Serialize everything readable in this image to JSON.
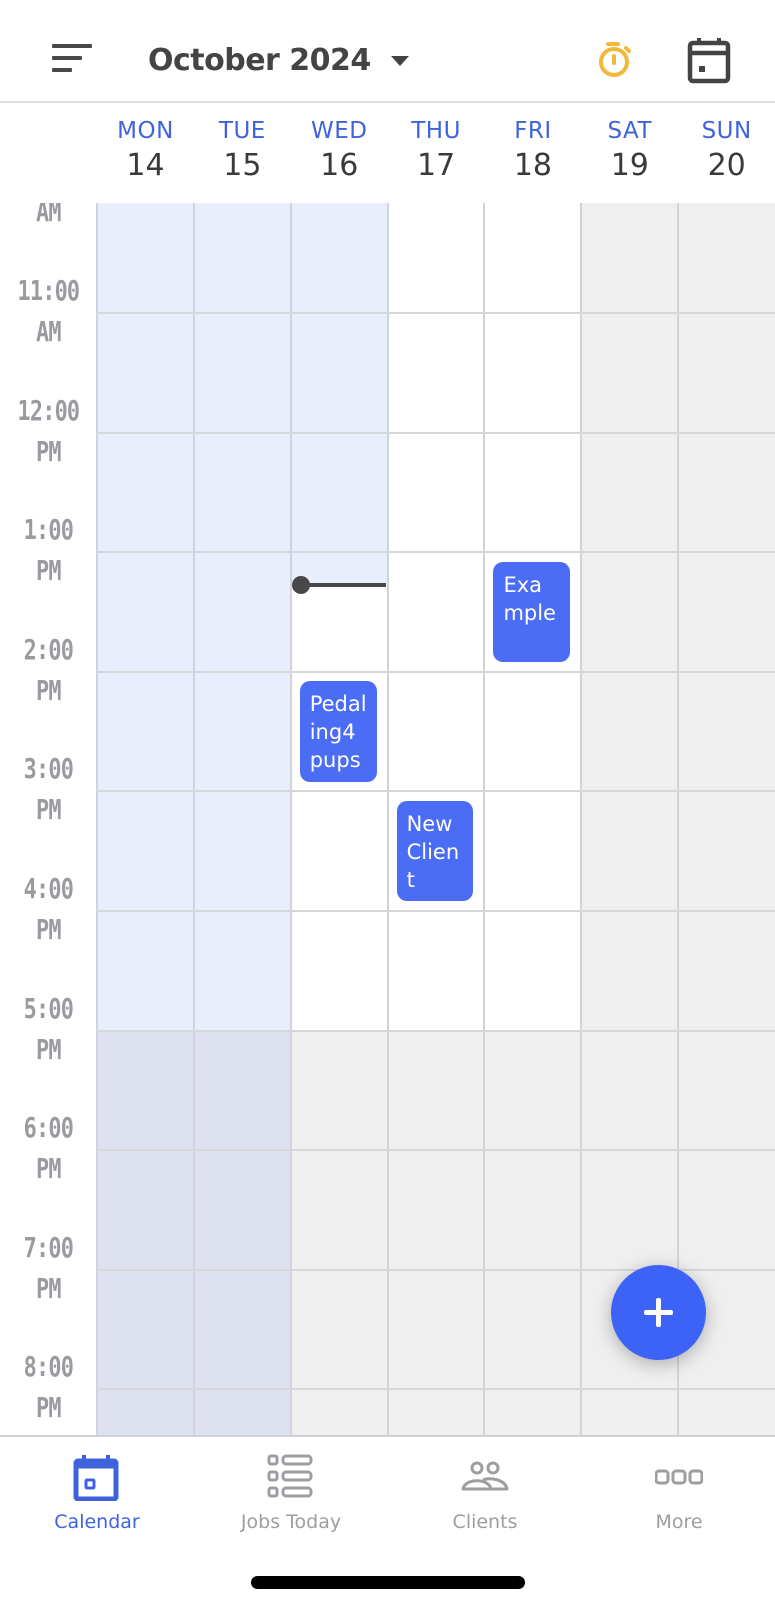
{
  "header": {
    "menu_icon": "sort-lines-icon",
    "month_title": "October 2024",
    "dropdown_icon": "caret-down-icon",
    "timer_icon": "stopwatch-icon",
    "today_icon": "calendar-today-icon",
    "timer_color": "#f0b93a"
  },
  "week": {
    "days": [
      {
        "name": "MON",
        "date": "14"
      },
      {
        "name": "TUE",
        "date": "15"
      },
      {
        "name": "WED",
        "date": "16"
      },
      {
        "name": "THU",
        "date": "17"
      },
      {
        "name": "FRI",
        "date": "18"
      },
      {
        "name": "SAT",
        "date": "19"
      },
      {
        "name": "SUN",
        "date": "20"
      }
    ],
    "day_name_color": "#3e63dd"
  },
  "time_labels": [
    {
      "hour": "",
      "period": "AM"
    },
    {
      "hour": "11:00",
      "period": "AM"
    },
    {
      "hour": "12:00",
      "period": "PM"
    },
    {
      "hour": "1:00",
      "period": "PM"
    },
    {
      "hour": "2:00",
      "period": "PM"
    },
    {
      "hour": "3:00",
      "period": "PM"
    },
    {
      "hour": "4:00",
      "period": "PM"
    },
    {
      "hour": "5:00",
      "period": "PM"
    },
    {
      "hour": "6:00",
      "period": "PM"
    },
    {
      "hour": "7:00",
      "period": "PM"
    },
    {
      "hour": "8:00",
      "period": "PM"
    }
  ],
  "view": {
    "first_visible_hour": 10.08,
    "business_hours_end": 17,
    "current_day_index": 2,
    "current_time_hour": 13.27
  },
  "events": [
    {
      "title": "Example",
      "day_index": 4,
      "start_hour": 13.08,
      "end_hour": 13.92
    },
    {
      "title": "Pedaling4pups",
      "day_index": 2,
      "start_hour": 14.08,
      "end_hour": 14.92
    },
    {
      "title": "New Client",
      "day_index": 3,
      "start_hour": 15.08,
      "end_hour": 15.92
    }
  ],
  "colors": {
    "event": "#4b6cf5",
    "past_business": "#e9eefc",
    "past_after_hours": "#dde1ef",
    "after_hours": "#efefef",
    "weekend": "#efefef",
    "accent": "#3e63dd"
  },
  "fab": {
    "icon": "plus-icon"
  },
  "tabbar": {
    "tabs": [
      {
        "label": "Calendar",
        "icon": "calendar-icon",
        "active": true
      },
      {
        "label": "Jobs Today",
        "icon": "list-icon",
        "active": false
      },
      {
        "label": "Clients",
        "icon": "people-icon",
        "active": false
      },
      {
        "label": "More",
        "icon": "more-dots-icon",
        "active": false
      }
    ]
  }
}
